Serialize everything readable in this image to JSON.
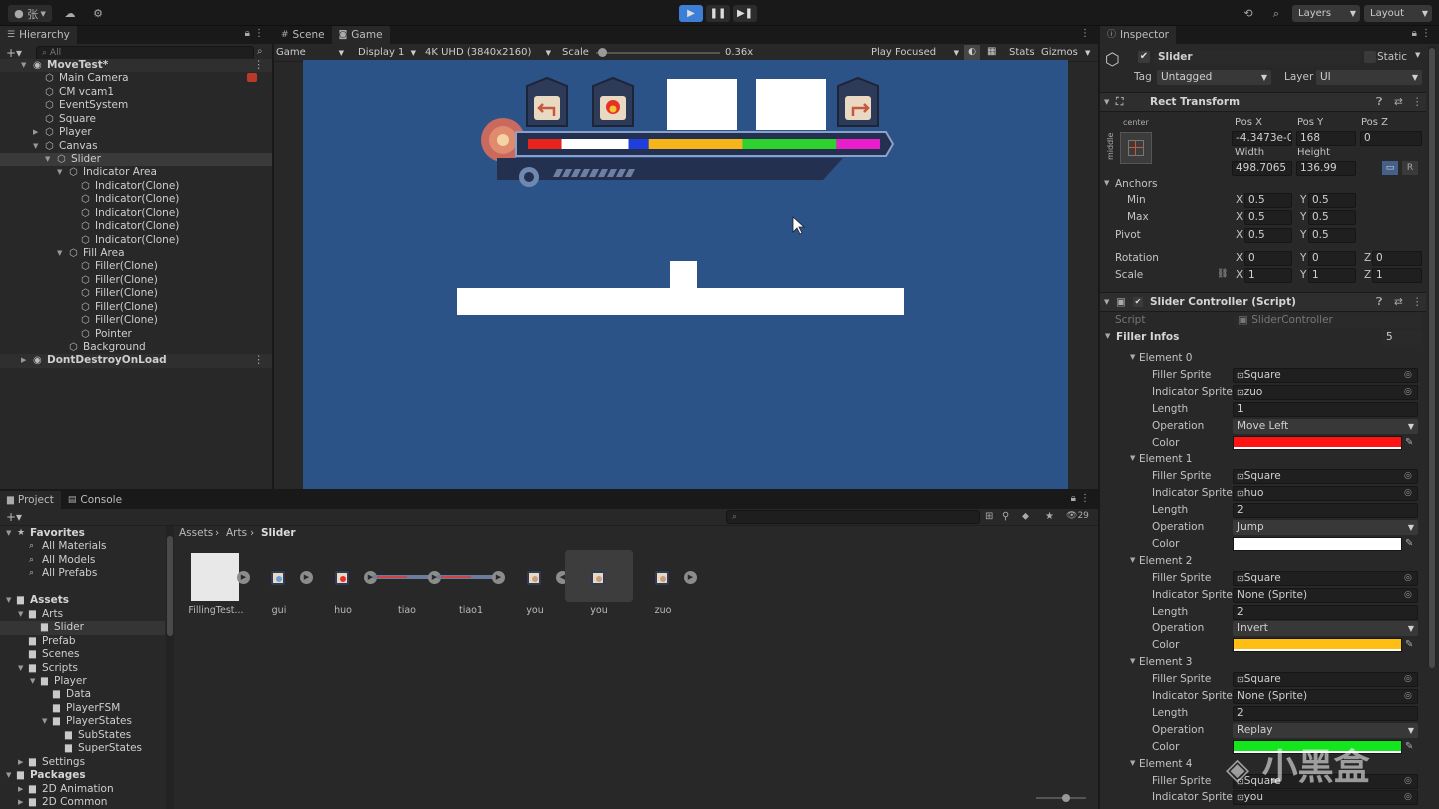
{
  "toolbar": {
    "account_label": "张",
    "layers_label": "Layers",
    "layout_label": "Layout",
    "play_icon": "play-icon",
    "pause_icon": "pause-icon",
    "step_icon": "step-icon",
    "active_color": "#3d7fd6"
  },
  "hierarchy": {
    "tab_label": "Hierarchy",
    "search_placeholder": "All",
    "rows": [
      {
        "label": "MoveTest*",
        "depth": 0,
        "icon": "unity-scene-icon",
        "fold": "open",
        "kebab": true,
        "root": true
      },
      {
        "label": "Main Camera",
        "depth": 1,
        "icon": "gameobject-icon"
      },
      {
        "label": "CM vcam1",
        "depth": 1,
        "icon": "gameobject-icon"
      },
      {
        "label": "EventSystem",
        "depth": 1,
        "icon": "gameobject-icon"
      },
      {
        "label": "Square",
        "depth": 1,
        "icon": "gameobject-icon"
      },
      {
        "label": "Player",
        "depth": 1,
        "icon": "gameobject-icon",
        "fold": "closed"
      },
      {
        "label": "Canvas",
        "depth": 1,
        "icon": "gameobject-icon",
        "fold": "open"
      },
      {
        "label": "Slider",
        "depth": 2,
        "icon": "gameobject-icon",
        "fold": "open",
        "selected": true
      },
      {
        "label": "Indicator Area",
        "depth": 3,
        "icon": "gameobject-icon",
        "fold": "open"
      },
      {
        "label": "Indicator(Clone)",
        "depth": 4,
        "icon": "gameobject-icon"
      },
      {
        "label": "Indicator(Clone)",
        "depth": 4,
        "icon": "gameobject-icon"
      },
      {
        "label": "Indicator(Clone)",
        "depth": 4,
        "icon": "gameobject-icon"
      },
      {
        "label": "Indicator(Clone)",
        "depth": 4,
        "icon": "gameobject-icon"
      },
      {
        "label": "Indicator(Clone)",
        "depth": 4,
        "icon": "gameobject-icon"
      },
      {
        "label": "Fill Area",
        "depth": 3,
        "icon": "gameobject-icon",
        "fold": "open"
      },
      {
        "label": "Filler(Clone)",
        "depth": 4,
        "icon": "gameobject-icon"
      },
      {
        "label": "Filler(Clone)",
        "depth": 4,
        "icon": "gameobject-icon"
      },
      {
        "label": "Filler(Clone)",
        "depth": 4,
        "icon": "gameobject-icon"
      },
      {
        "label": "Filler(Clone)",
        "depth": 4,
        "icon": "gameobject-icon"
      },
      {
        "label": "Filler(Clone)",
        "depth": 4,
        "icon": "gameobject-icon"
      },
      {
        "label": "Pointer",
        "depth": 4,
        "icon": "gameobject-icon"
      },
      {
        "label": "Background",
        "depth": 3,
        "icon": "gameobject-icon"
      },
      {
        "label": "DontDestroyOnLoad",
        "depth": 0,
        "icon": "unity-scene-icon",
        "fold": "closed",
        "kebab": true,
        "root": true
      }
    ]
  },
  "center": {
    "tabs": [
      {
        "label": "Scene",
        "icon": "scene-tab-icon",
        "active": false
      },
      {
        "label": "Game",
        "icon": "game-tab-icon",
        "active": true
      }
    ],
    "game_dropdown": "Game",
    "display_dropdown": "Display 1",
    "resolution_dropdown": "4K UHD (3840x2160)",
    "scale_label": "Scale",
    "scale_value": "0.36x",
    "scale_fraction": 0.05,
    "play_focused": "Play Focused",
    "stats_label": "Stats",
    "gizmos_label": "Gizmos",
    "game_bg_color": "#2b5387",
    "bar_segments": [
      {
        "color": "#e8221c",
        "length": 1
      },
      {
        "color": "#ffffff",
        "length": 2
      },
      {
        "color": "#1f3fdc",
        "length": 0.6
      },
      {
        "color": "#f7b51c",
        "length": 2.8
      },
      {
        "color": "#2fd12f",
        "length": 2.8
      },
      {
        "color": "#e61fc9",
        "length": 1.3
      }
    ]
  },
  "project": {
    "tabs": [
      {
        "label": "Project",
        "icon": "folder-tab-icon",
        "active": true
      },
      {
        "label": "Console",
        "icon": "console-tab-icon",
        "active": false
      }
    ],
    "breadcrumb": [
      "Assets",
      "Arts",
      "Slider"
    ],
    "visible_count": "29",
    "tree": [
      {
        "label": "Favorites",
        "depth": 0,
        "icon": "star-icon",
        "fold": "open",
        "bold": true
      },
      {
        "label": "All Materials",
        "depth": 1,
        "icon": "search-icon"
      },
      {
        "label": "All Models",
        "depth": 1,
        "icon": "search-icon"
      },
      {
        "label": "All Prefabs",
        "depth": 1,
        "icon": "search-icon"
      },
      {
        "label": "",
        "depth": 0,
        "icon": "",
        "spacer": true
      },
      {
        "label": "Assets",
        "depth": 0,
        "icon": "folder-icon",
        "fold": "open",
        "bold": true
      },
      {
        "label": "Arts",
        "depth": 1,
        "icon": "folder-icon",
        "fold": "open"
      },
      {
        "label": "Slider",
        "depth": 2,
        "icon": "folder-icon",
        "selected": true
      },
      {
        "label": "Prefab",
        "depth": 1,
        "icon": "folder-icon"
      },
      {
        "label": "Scenes",
        "depth": 1,
        "icon": "folder-icon"
      },
      {
        "label": "Scripts",
        "depth": 1,
        "icon": "folder-icon",
        "fold": "open"
      },
      {
        "label": "Player",
        "depth": 2,
        "icon": "folder-icon",
        "fold": "open"
      },
      {
        "label": "Data",
        "depth": 3,
        "icon": "folder-icon"
      },
      {
        "label": "PlayerFSM",
        "depth": 3,
        "icon": "folder-icon"
      },
      {
        "label": "PlayerStates",
        "depth": 3,
        "icon": "folder-icon",
        "fold": "open"
      },
      {
        "label": "SubStates",
        "depth": 4,
        "icon": "folder-icon"
      },
      {
        "label": "SuperStates",
        "depth": 4,
        "icon": "folder-icon"
      },
      {
        "label": "Settings",
        "depth": 1,
        "icon": "folder-icon",
        "fold": "closed"
      },
      {
        "label": "Packages",
        "depth": 0,
        "icon": "folder-icon",
        "fold": "open",
        "bold": true
      },
      {
        "label": "2D Animation",
        "depth": 1,
        "icon": "folder-icon",
        "fold": "closed"
      },
      {
        "label": "2D Common",
        "depth": 1,
        "icon": "folder-icon",
        "fold": "closed"
      }
    ],
    "assets": [
      {
        "name": "FillingTest...",
        "thumb": "white-square",
        "play": true
      },
      {
        "name": "gui",
        "thumb": "gui-icon",
        "play": true
      },
      {
        "name": "huo",
        "thumb": "fire-icon",
        "play": true
      },
      {
        "name": "tiao",
        "thumb": "slider-bar",
        "play": true
      },
      {
        "name": "tiao1",
        "thumb": "slider-bar",
        "play": true
      },
      {
        "name": "you",
        "thumb": "arrow-icon",
        "play": false,
        "play_left": true
      },
      {
        "name": "you",
        "thumb": "arrow-icon",
        "play": false,
        "selected": true
      },
      {
        "name": "zuo",
        "thumb": "arrow-icon",
        "play": true
      }
    ]
  },
  "inspector": {
    "tab_label": "Inspector",
    "object_name": "Slider",
    "static_label": "Static",
    "tag_label": "Tag",
    "tag_value": "Untagged",
    "layer_label": "Layer",
    "layer_value": "UI",
    "rect_transform": {
      "title": "Rect Transform",
      "anchor_h": "center",
      "anchor_v": "middle",
      "pos_x_label": "Pos X",
      "pos_x": "-4.3473e-0",
      "pos_y_label": "Pos Y",
      "pos_y": "168",
      "pos_z_label": "Pos Z",
      "pos_z": "0",
      "width_label": "Width",
      "width": "498.7065",
      "height_label": "Height",
      "height": "136.99",
      "anchors_label": "Anchors",
      "min_label": "Min",
      "min_x": "0.5",
      "min_y": "0.5",
      "max_label": "Max",
      "max_x": "0.5",
      "max_y": "0.5",
      "pivot_label": "Pivot",
      "pivot_x": "0.5",
      "pivot_y": "0.5",
      "rotation_label": "Rotation",
      "rot_x": "0",
      "rot_y": "0",
      "rot_z": "0",
      "scale_label": "Scale",
      "scale_x": "1",
      "scale_y": "1",
      "scale_z": "1",
      "x_label": "X",
      "y_label": "Y",
      "z_label": "Z",
      "blueprint_label": "R"
    },
    "script_component": {
      "title": "Slider Controller (Script)",
      "script_label": "Script",
      "script_value": "SliderController",
      "filler_infos_label": "Filler Infos",
      "filler_count": "5",
      "field_labels": {
        "filler_sprite": "Filler Sprite",
        "indicator_sprite": "Indicator Sprite",
        "length": "Length",
        "operation": "Operation",
        "color": "Color"
      },
      "elements": [
        {
          "title": "Element 0",
          "filler_sprite": "Square",
          "indicator_sprite": "zuo",
          "length": "1",
          "operation": "Move Left",
          "color": "#ff1414"
        },
        {
          "title": "Element 1",
          "filler_sprite": "Square",
          "indicator_sprite": "huo",
          "length": "2",
          "operation": "Jump",
          "color": "#ffffff"
        },
        {
          "title": "Element 2",
          "filler_sprite": "Square",
          "indicator_sprite": "None (Sprite)",
          "length": "2",
          "operation": "Invert",
          "color": "#ffbe14"
        },
        {
          "title": "Element 3",
          "filler_sprite": "Square",
          "indicator_sprite": "None (Sprite)",
          "length": "2",
          "operation": "Replay",
          "color": "#14e61e"
        },
        {
          "title": "Element 4",
          "filler_sprite": "Square",
          "indicator_sprite": "you"
        }
      ]
    },
    "watermark": "小黑盒"
  }
}
